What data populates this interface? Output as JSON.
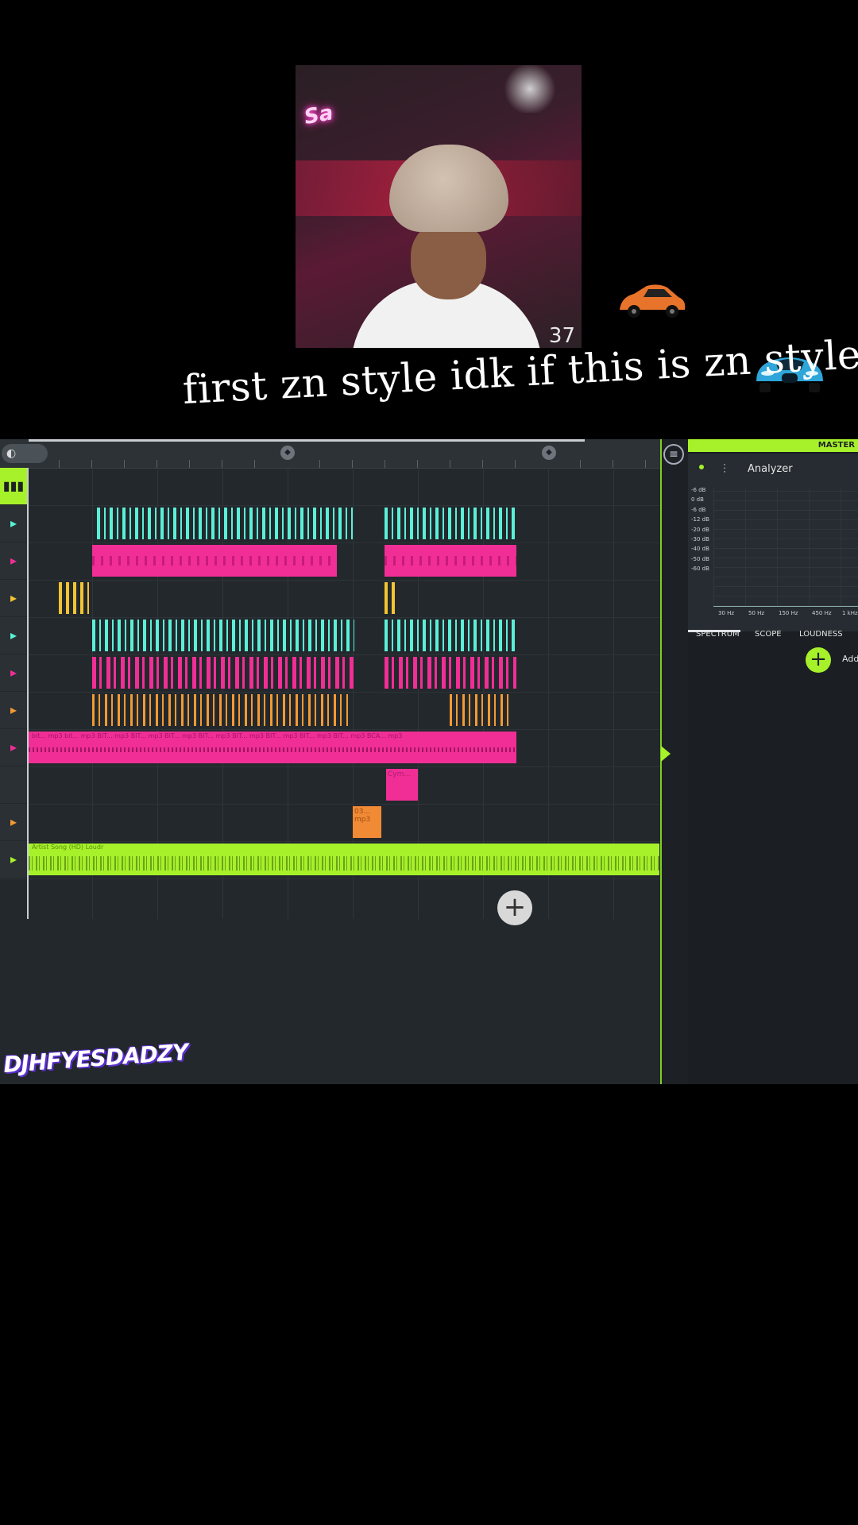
{
  "video": {
    "neon_sign": "Sa",
    "counter": "37",
    "caption": "first zn style idk if this is zn style"
  },
  "daw": {
    "playlist": {
      "clip_labels": {
        "long_pink": "bit... mp3 bit... mp3 BIT... mp3 BIT... mp3 BIT... mp3 BIT... mp3 BIT... mp3 BIT... mp3 BIT... mp3 BIT... mp3 BCA... mp3",
        "green_main": "Artist Song (HD) Loudr",
        "orange_block": "03... mp3",
        "pink_block": "Cym..."
      },
      "add_track_symbol": "+"
    },
    "master": {
      "header": "MASTER",
      "analyzer_title": "Analyzer",
      "db_scale": [
        "-6 dB",
        "0 dB",
        "-6 dB",
        "-12 dB",
        "-20 dB",
        "-30 dB",
        "-40 dB",
        "-50 dB",
        "-60 dB"
      ],
      "hz_scale": [
        "30 Hz",
        "50 Hz",
        "150 Hz",
        "450 Hz",
        "1 kHz"
      ],
      "tabs": [
        "SPECTRUM",
        "SCOPE",
        "LOUDNESS"
      ],
      "add_label": "Add"
    }
  },
  "watermark": "DJHFYESDADZY",
  "colors": {
    "accent_green": "#a6f12a",
    "teal": "#59f0d8",
    "pink": "#f02e96",
    "orange": "#f39a33",
    "yellow": "#f2c431"
  }
}
